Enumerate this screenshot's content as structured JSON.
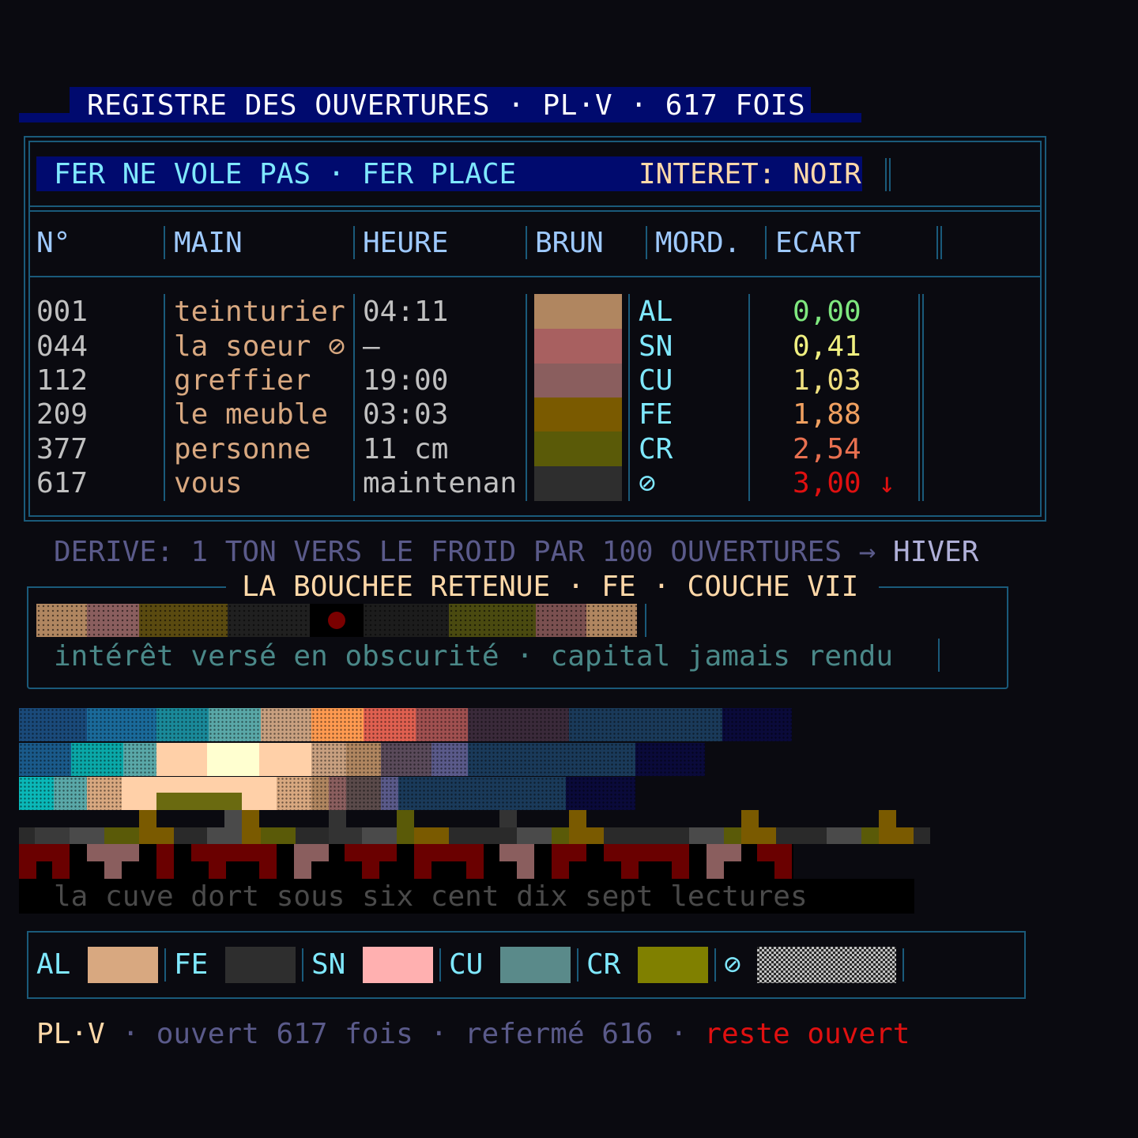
{
  "title": "REGISTRE DES OUVERTURES · PL·V · 617 FOIS",
  "banner": {
    "left": "FER NE VOLE PAS · FER PLACE",
    "right": "INTERET: NOIR"
  },
  "table": {
    "headers": [
      "N°",
      "MAIN",
      "HEURE",
      "BRUN",
      "MORD.",
      "ECART"
    ],
    "rows": [
      {
        "num": "001",
        "hand": "teinturier",
        "time": "04:11",
        "brun": "#b08660",
        "mord": "AL",
        "ecart": "0,00",
        "ecart_color": "#7fe87f"
      },
      {
        "num": "044",
        "hand": "la soeur ⊘",
        "time": "—",
        "brun": "#a86060",
        "mord": "SN",
        "ecart": "0,41",
        "ecart_color": "#f0f080"
      },
      {
        "num": "112",
        "hand": "greffier",
        "time": "19:00",
        "brun": "#8a5e5e",
        "mord": "CU",
        "ecart": "1,03",
        "ecart_color": "#f0e080"
      },
      {
        "num": "209",
        "hand": "le meuble",
        "time": "03:03",
        "brun": "#7a5a00",
        "mord": "FE",
        "ecart": "1,88",
        "ecart_color": "#f0a060"
      },
      {
        "num": "377",
        "hand": "personne",
        "time": "11 cm",
        "brun": "#5a5a08",
        "mord": "CR",
        "ecart": "2,54",
        "ecart_color": "#e87050"
      },
      {
        "num": "617",
        "hand": "vous",
        "time": "maintenan",
        "brun": "#2e2e2e",
        "mord": "⊘",
        "ecart": "3,00 ↓",
        "ecart_color": "#e01010"
      }
    ]
  },
  "drift": {
    "text": "DERIVE: 1 TON VERS LE FROID PAR 100 OUVERTURES →",
    "end": "HIVER"
  },
  "bouchee": {
    "title": "LA BOUCHEE RETENUE · FE · COUCHE VII",
    "caption": "intérêt versé en obscurité · capital jamais rendu"
  },
  "cuve": "la cuve dort sous six cent dix sept lectures",
  "legend": [
    {
      "label": "AL",
      "color": "#d8a880"
    },
    {
      "label": "FE",
      "color": "#2e2e2e"
    },
    {
      "label": "SN",
      "color": "#ffb0b0"
    },
    {
      "label": "CU",
      "color": "#5a8a8a"
    },
    {
      "label": "CR",
      "color": "#808000"
    },
    {
      "label": "⊘",
      "color": "checker"
    }
  ],
  "footer": {
    "a": "PL·V",
    "b": " · ouvert 617 fois · refermé 616 · ",
    "c": "reste ouvert"
  }
}
